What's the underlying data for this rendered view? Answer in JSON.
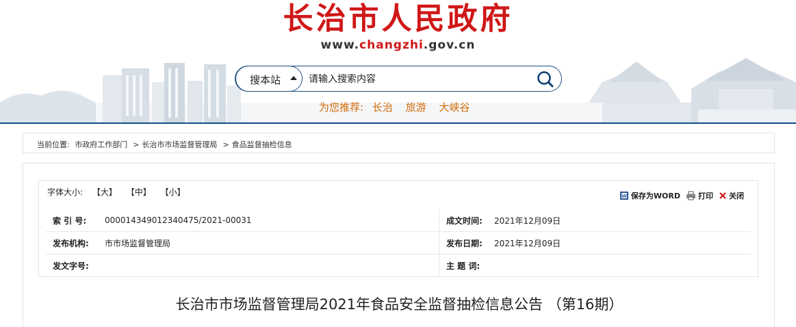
{
  "header": {
    "title": "长治市人民政府",
    "url_prefix": "www.",
    "url_highlight": "changzhi",
    "url_suffix": ".gov.cn",
    "search": {
      "scope_label": "搜本站",
      "placeholder": "请输入搜索内容"
    },
    "recommend": {
      "label": "为您推荐:",
      "items": [
        "长治",
        "旅游",
        "大峡谷"
      ]
    }
  },
  "breadcrumb": {
    "label": "当前位置:",
    "items": [
      "市政府工作部门",
      "长治市市场监督管理局",
      "食品监督抽检信息"
    ],
    "separator": ">"
  },
  "font_size": {
    "label": "字体大小:",
    "options": [
      "【大】",
      "【中】",
      "【小】"
    ]
  },
  "tools": {
    "save_word": "保存为WORD",
    "print": "打印",
    "close": "关闭"
  },
  "meta": {
    "index_label": "索 引 号:",
    "index_value": "000014349012340475/2021-00031",
    "date_written_label": "成文时间:",
    "date_written_value": "2021年12月09日",
    "publisher_label": "发布机构:",
    "publisher_value": "市市场监督管理局",
    "publish_date_label": "发布日期:",
    "publish_date_value": "2021年12月09日",
    "doc_no_label": "发文字号:",
    "doc_no_value": "",
    "subject_label": "主  题 词:",
    "subject_value": ""
  },
  "article": {
    "title": "长治市市场监督管理局2021年食品安全监督抽检信息公告 （第16期）"
  },
  "colors": {
    "brand_red": "#d01717",
    "nav_blue": "#0d4d8a",
    "recommend_orange": "#d46b08"
  }
}
